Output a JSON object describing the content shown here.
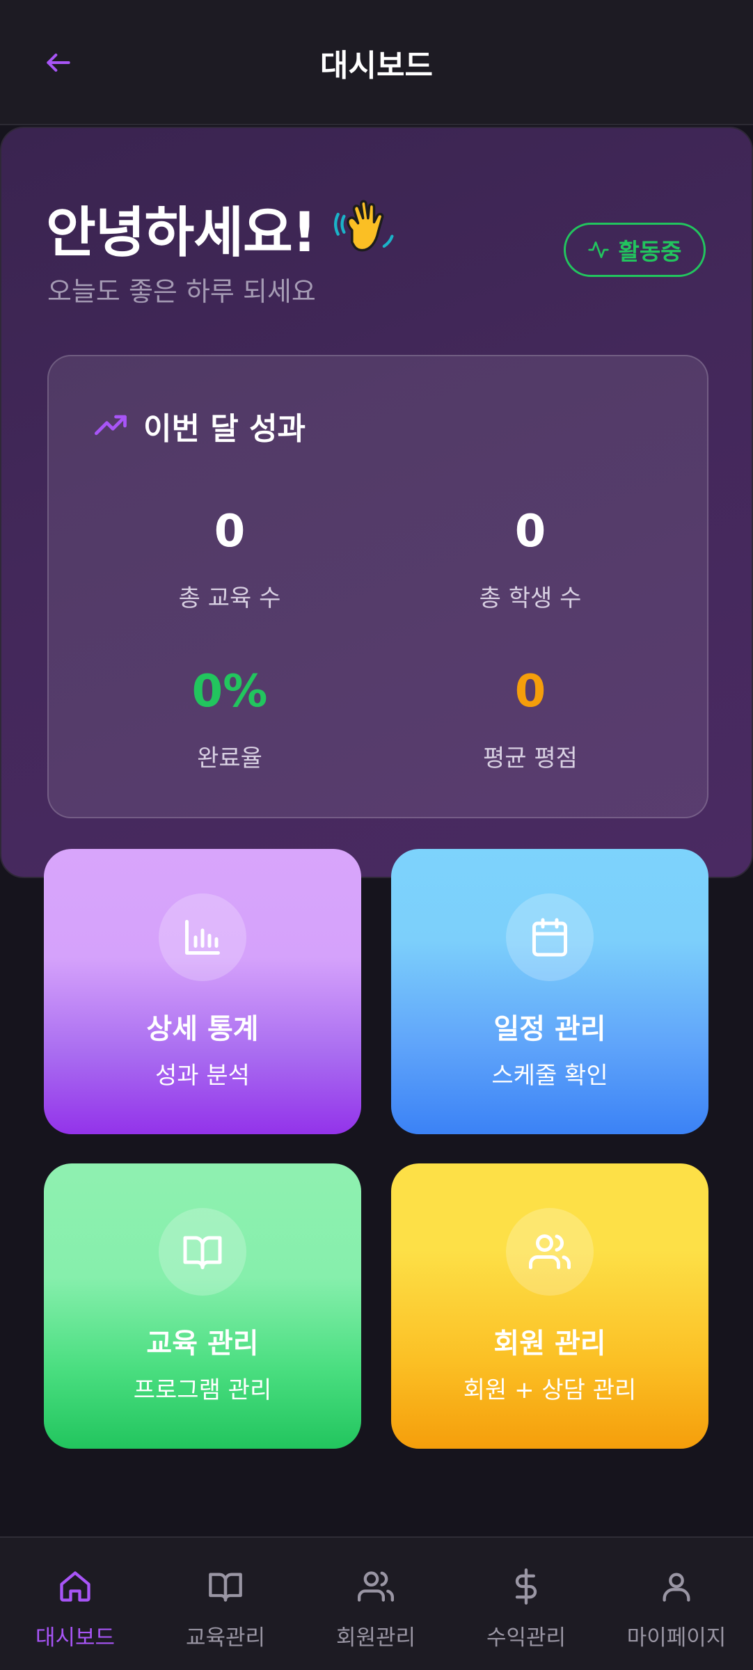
{
  "header": {
    "title": "대시보드"
  },
  "hero": {
    "greeting": "안녕하세요!",
    "subgreeting": "오늘도 좋은 하루 되세요",
    "status_label": "활동중",
    "status_color": "#22c55e"
  },
  "stats": {
    "title": "이번 달 성과",
    "items": [
      {
        "value": "0",
        "label": "총 교육 수",
        "color": "#ffffff"
      },
      {
        "value": "0",
        "label": "총 학생 수",
        "color": "#ffffff"
      },
      {
        "value": "0%",
        "label": "완료율",
        "color": "#22c55e"
      },
      {
        "value": "0",
        "label": "평균 평점",
        "color": "#f59e0b"
      }
    ]
  },
  "tiles": [
    {
      "title": "상세 통계",
      "subtitle": "성과 분석",
      "icon": "bar-chart-icon"
    },
    {
      "title": "일정 관리",
      "subtitle": "스케줄 확인",
      "icon": "calendar-icon"
    },
    {
      "title": "교육 관리",
      "subtitle": "프로그램 관리",
      "icon": "book-icon"
    },
    {
      "title": "회원 관리",
      "subtitle": "회원 + 상담 관리",
      "icon": "users-icon"
    }
  ],
  "nav": {
    "active_color": "#a855f7",
    "items": [
      {
        "label": "대시보드",
        "icon": "home-icon",
        "active": true
      },
      {
        "label": "교육관리",
        "icon": "book-icon",
        "active": false
      },
      {
        "label": "회원관리",
        "icon": "users-icon",
        "active": false
      },
      {
        "label": "수익관리",
        "icon": "dollar-icon",
        "active": false
      },
      {
        "label": "마이페이지",
        "icon": "user-icon",
        "active": false
      }
    ]
  }
}
